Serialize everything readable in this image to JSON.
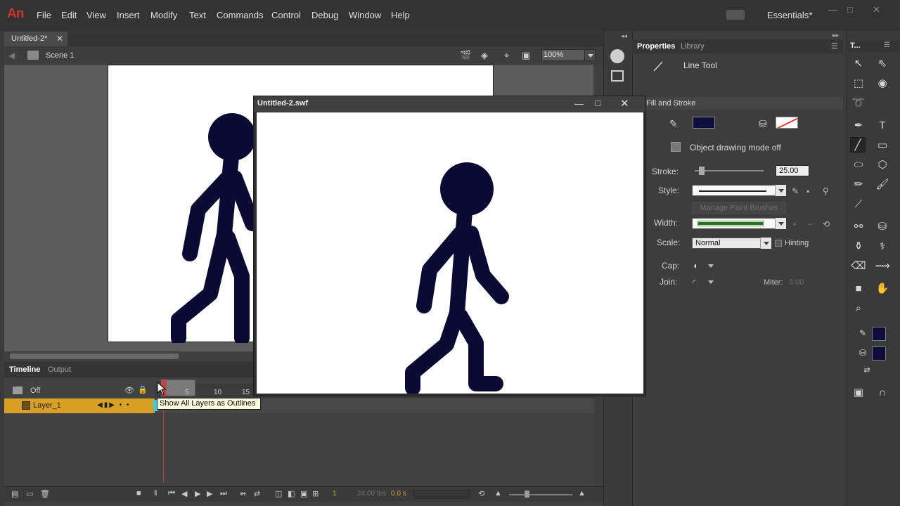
{
  "app": {
    "logo": "An",
    "menu": [
      "File",
      "Edit",
      "View",
      "Insert",
      "Modify",
      "Text",
      "Commands",
      "Control",
      "Debug",
      "Window",
      "Help"
    ],
    "workspace": "Essentials",
    "window_controls": {
      "minimize": "—",
      "restore": "□",
      "close": "✕"
    }
  },
  "document": {
    "tab_title": "Untitled-2*",
    "tab_close": "✕",
    "scene_label": "Scene 1",
    "zoom": "100%"
  },
  "timeline": {
    "tabs": {
      "timeline": "Timeline",
      "output": "Output"
    },
    "outline_label": "Off",
    "ticks": [
      "5",
      "10",
      "15"
    ],
    "layer_name": "Layer_1",
    "layer_controls": "◀▮▶ • •",
    "current_frame": "1",
    "fps": "24.00 fps",
    "elapsed": "0.0 s",
    "tooltip": "Show All Layers as Outlines"
  },
  "swf_window": {
    "title": "Untitled-2.swf",
    "min": "—",
    "max": "□",
    "close": "✕"
  },
  "properties": {
    "tab_properties": "Properties",
    "tab_library": "Library",
    "tool_name": "Line Tool",
    "section_fill_stroke": "Fill and Stroke",
    "stroke_color": "#0d0e3e",
    "object_drawing": "Object drawing mode off",
    "stroke_label": "Stroke:",
    "stroke_value": "25.00",
    "style_label": "Style:",
    "manage_brushes": "Manage Paint Brushes",
    "width_label": "Width:",
    "scale_label": "Scale:",
    "scale_value": "Normal",
    "hinting_label": "Hinting",
    "cap_label": "Cap:",
    "join_label": "Join:",
    "miter_label": "Miter:",
    "miter_value": "3.00"
  },
  "tools": {
    "title": "T..."
  },
  "colors": {
    "figure": "#0a0b33",
    "accent_layer": "#d8a126"
  }
}
